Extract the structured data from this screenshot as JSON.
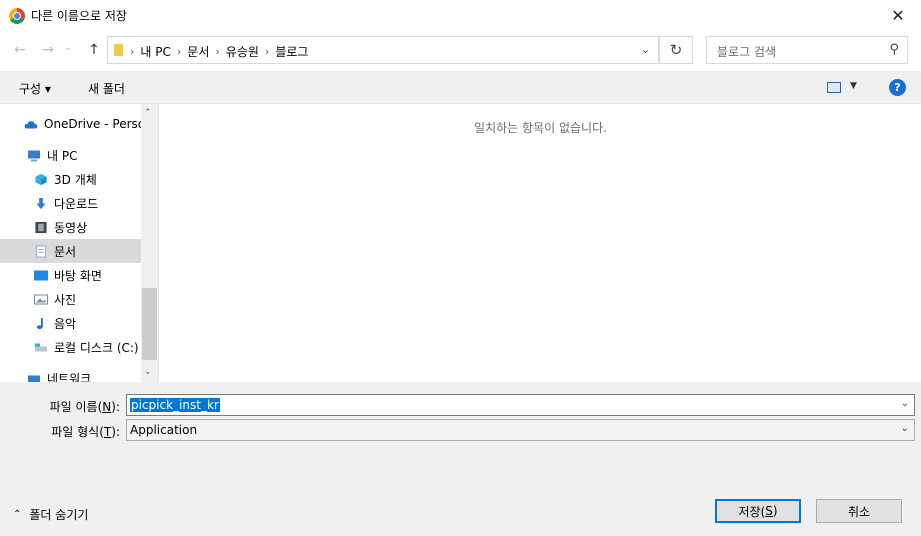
{
  "window": {
    "title": "다른 이름으로 저장",
    "close_glyph": "✕"
  },
  "nav": {
    "back_glyph": "←",
    "forward_glyph": "→",
    "recent_glyph": "⌄",
    "up_glyph": "↑",
    "breadcrumb": [
      "내 PC",
      "문서",
      "유승원",
      "블로그"
    ],
    "breadcrumb_sep": "›",
    "refresh_glyph": "↻",
    "search_placeholder": "블로그 검색"
  },
  "toolbar": {
    "organize_label": "구성 ▾",
    "new_folder_label": "새 폴더",
    "help_glyph": "?",
    "view_dropdown_glyph": "▼"
  },
  "sidebar": {
    "items": [
      {
        "label": "OneDrive - Personal",
        "icon": "cloud-icon",
        "color": "#1e73d2"
      },
      {
        "label": "내 PC",
        "icon": "computer-icon",
        "color": "#3a7bc8"
      },
      {
        "label": "3D 개체",
        "icon": "cube-icon",
        "color": "#2fb3e0"
      },
      {
        "label": "다운로드",
        "icon": "download-icon",
        "color": "#2f7fd8"
      },
      {
        "label": "동영상",
        "icon": "film-icon",
        "color": "#555555"
      },
      {
        "label": "문서",
        "icon": "document-icon",
        "color": "#8fa7c2"
      },
      {
        "label": "바탕 화면",
        "icon": "desktop-icon",
        "color": "#1e88e5"
      },
      {
        "label": "사진",
        "icon": "picture-icon",
        "color": "#6e8bb0"
      },
      {
        "label": "음악",
        "icon": "music-icon",
        "color": "#1e73d2"
      },
      {
        "label": "로컬 디스크 (C:)",
        "icon": "drive-icon",
        "color": "#7aa3c7"
      },
      {
        "label": "네트워크",
        "icon": "network-icon",
        "color": "#3a7bc8"
      }
    ],
    "selected_index": 5
  },
  "content": {
    "empty_message": "일치하는 항목이 없습니다."
  },
  "form": {
    "filename_label_prefix": "파일 이름(",
    "filename_label_key": "N",
    "filename_label_suffix": "):",
    "filename_value": "picpick_inst_kr",
    "filetype_label_prefix": "파일 형식(",
    "filetype_label_key": "T",
    "filetype_label_suffix": "):",
    "filetype_value": "Application"
  },
  "footer": {
    "hide_folders_label": "폴더 숨기기",
    "save_label_prefix": "저장(",
    "save_label_key": "S",
    "save_label_suffix": ")",
    "cancel_label": "취소"
  },
  "colors": {
    "accent": "#0078d7",
    "selected_row": "#dadada"
  }
}
